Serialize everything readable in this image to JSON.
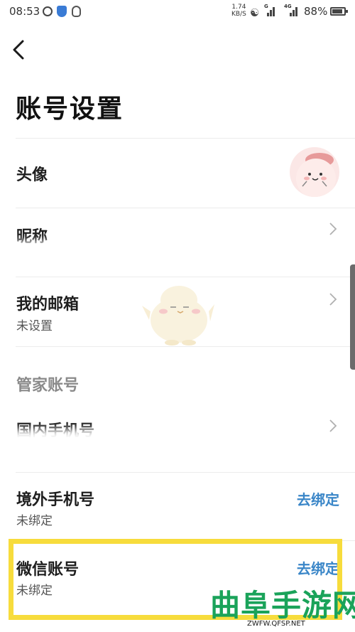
{
  "status_bar": {
    "time": "08:53",
    "net_speed_value": "1.74",
    "net_speed_unit": "KB/S",
    "signal1_tag": "G",
    "signal2_tag": "4G",
    "battery": "88%",
    "icons": [
      "alarm-icon",
      "shield-icon",
      "qq-icon",
      "wifi-icon",
      "signal-icon",
      "battery-icon"
    ]
  },
  "page": {
    "title": "账号设置"
  },
  "rows": {
    "avatar": {
      "label": "头像"
    },
    "nickname": {
      "label": "昵称"
    },
    "email": {
      "label": "我的邮箱",
      "value": "未设置"
    },
    "section": {
      "label": "管家账号"
    },
    "domestic_phone": {
      "label": "国内手机号"
    },
    "overseas_phone": {
      "label": "境外手机号",
      "value": "未绑定",
      "action": "去绑定"
    },
    "wechat": {
      "label": "微信账号",
      "value": "未绑定",
      "action": "去绑定"
    }
  },
  "colors": {
    "link": "#3a86c8",
    "highlight": "#f7dc3c",
    "watermark": "#1aa35a"
  },
  "watermark": {
    "text": "曲阜手游网",
    "url": "ZWFW.QFSP.NET"
  }
}
